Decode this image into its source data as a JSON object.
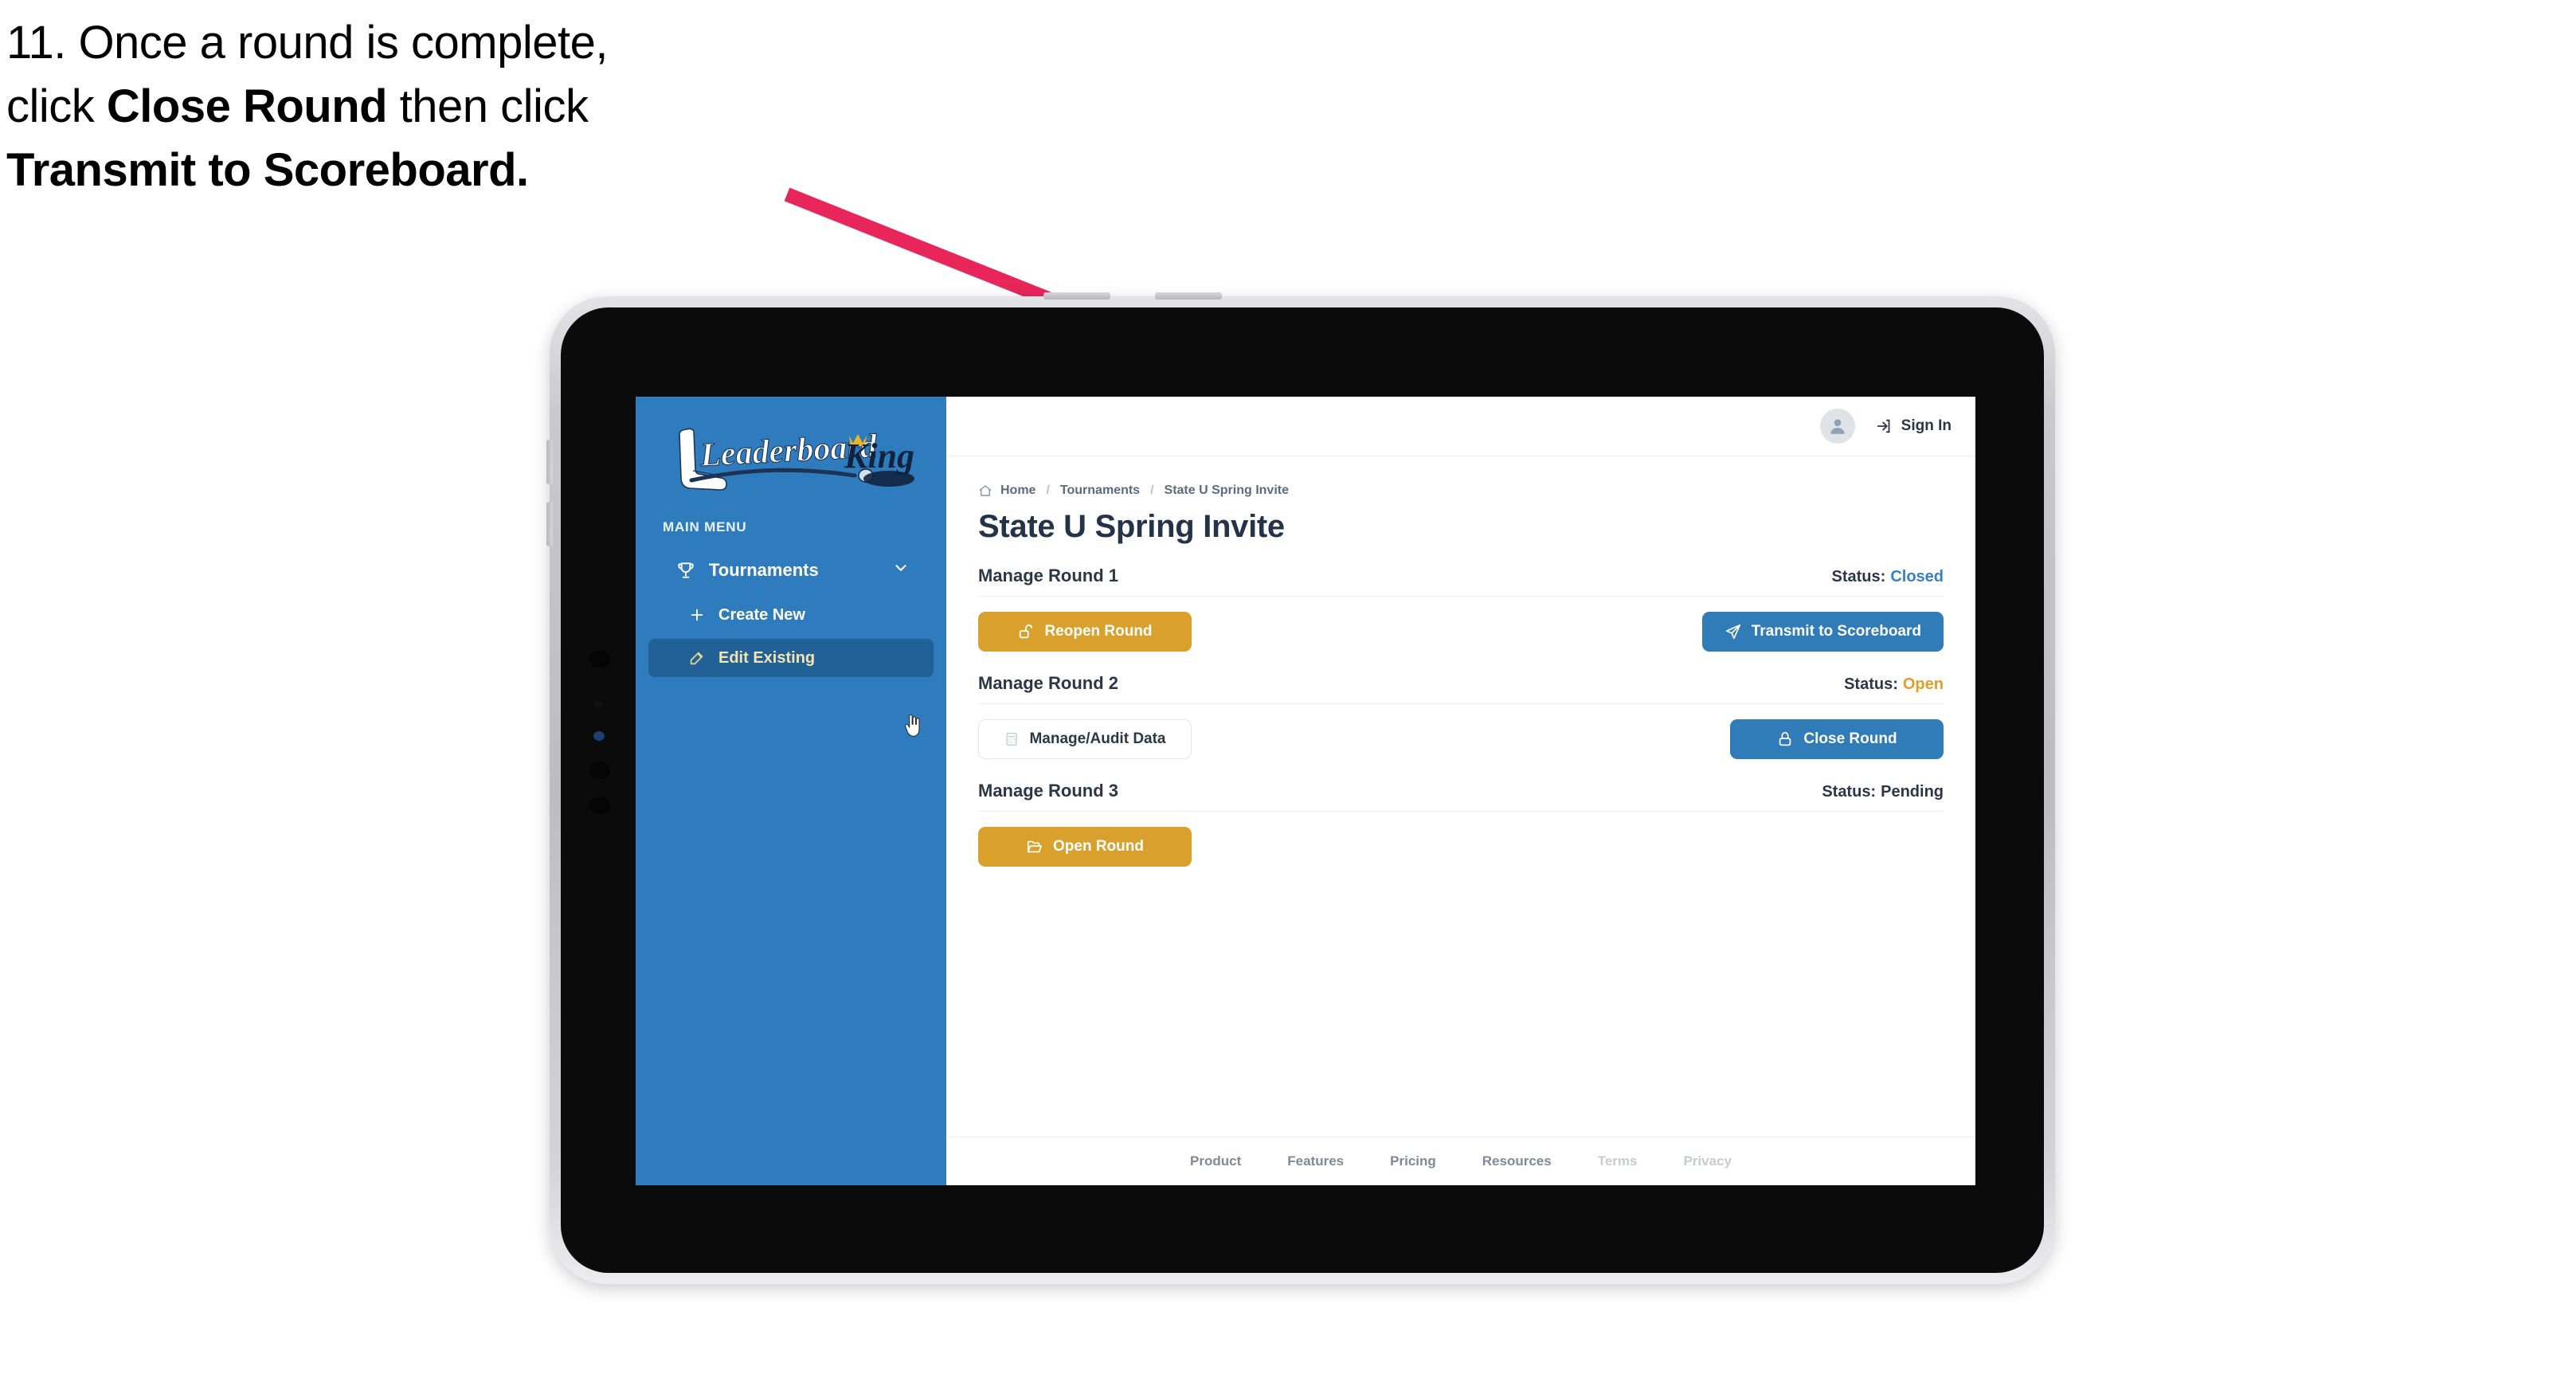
{
  "caption": {
    "line1_plain": "11. Once a round is complete,",
    "line2_pre": "click ",
    "line2_bold": "Close Round",
    "line2_post": " then click",
    "line3_bold": "Transmit to Scoreboard."
  },
  "colors": {
    "sidebar_blue": "#2E7CBE",
    "sidebar_active": "#226196",
    "primary_blue": "#2F7CB8",
    "gold": "#D9A02B",
    "annotation_pink": "#E8265C",
    "title_navy": "#25334A",
    "crown_gold": "#E8B52A"
  },
  "sidebar": {
    "logo": {
      "word1": "Leaderboard",
      "word2": "King",
      "icon_club": "golf-club-icon",
      "icon_crown": "crown-icon"
    },
    "section_label": "MAIN MENU",
    "items": [
      {
        "label": "Tournaments",
        "icon": "trophy-icon",
        "chevron": "chevron-down-icon",
        "level": "top",
        "active": false
      },
      {
        "label": "Create New",
        "icon": "plus-icon",
        "level": "sub",
        "active": false
      },
      {
        "label": "Edit Existing",
        "icon": "edit-square-icon",
        "level": "sub",
        "active": true
      }
    ],
    "cursor": "hand-pointer-cursor"
  },
  "topbar": {
    "avatar_icon": "user-avatar-icon",
    "signin_icon": "sign-in-icon",
    "signin_label": "Sign In"
  },
  "breadcrumb": {
    "home_icon": "home-icon",
    "items": [
      "Home",
      "Tournaments",
      "State U Spring Invite"
    ],
    "separator": "/"
  },
  "page": {
    "title": "State U Spring Invite"
  },
  "rounds": [
    {
      "title": "Manage Round 1",
      "status_label": "Status:",
      "status_value": "Closed",
      "status_kind": "closed",
      "left_button": {
        "label": "Reopen Round",
        "icon": "unlock-icon",
        "style": "gold"
      },
      "right_button": {
        "label": "Transmit to Scoreboard",
        "icon": "paper-plane-icon",
        "style": "blue"
      }
    },
    {
      "title": "Manage Round 2",
      "status_label": "Status:",
      "status_value": "Open",
      "status_kind": "open",
      "left_button": {
        "label": "Manage/Audit Data",
        "icon": "calculator-icon",
        "style": "ghost"
      },
      "right_button": {
        "label": "Close Round",
        "icon": "lock-icon",
        "style": "blue"
      }
    },
    {
      "title": "Manage Round 3",
      "status_label": "Status:",
      "status_value": "Pending",
      "status_kind": "pending",
      "left_button": {
        "label": "Open Round",
        "icon": "folder-open-icon",
        "style": "gold"
      },
      "right_button": null
    }
  ],
  "footer": {
    "links": [
      {
        "label": "Product",
        "muted": false
      },
      {
        "label": "Features",
        "muted": false
      },
      {
        "label": "Pricing",
        "muted": false
      },
      {
        "label": "Resources",
        "muted": false
      },
      {
        "label": "Terms",
        "muted": true
      },
      {
        "label": "Privacy",
        "muted": true
      }
    ]
  },
  "annotation": {
    "type": "arrow",
    "points_to": "Transmit to Scoreboard"
  }
}
